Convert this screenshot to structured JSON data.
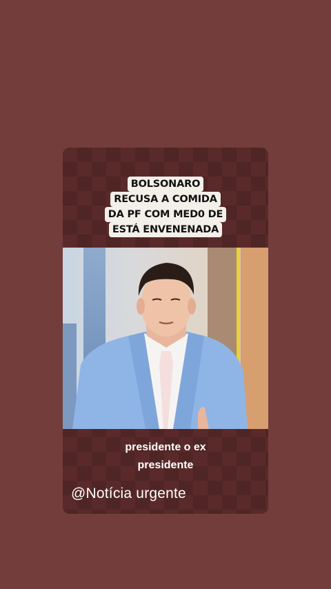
{
  "post": {
    "headline_lines": [
      "BOLSONARO",
      "RECUSA A COMIDA",
      "DA PF COM MED0 DE",
      "ESTÁ ENVENENADA"
    ],
    "caption_lines": [
      "presidente o ex",
      "presidente"
    ],
    "watermark": "@Notícia urgente"
  },
  "colors": {
    "page_background": "#733d3b",
    "card_background": "#5a2a2a",
    "headline_box": "#f3efe9",
    "suit": "#8fb5e6"
  }
}
